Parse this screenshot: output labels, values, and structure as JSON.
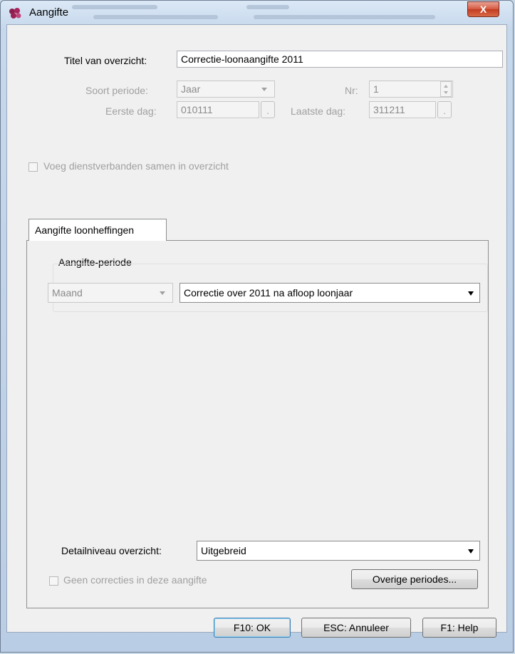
{
  "window": {
    "title": "Aangifte",
    "close_label": "X"
  },
  "form": {
    "titel_label": "Titel van overzicht:",
    "titel_value": "Correctie-loonaangifte 2011",
    "soort_label": "Soort periode:",
    "soort_value": "Jaar",
    "nr_label": "Nr:",
    "nr_value": "1",
    "eerste_label": "Eerste dag:",
    "eerste_value": "010111",
    "laatste_label": "Laatste dag:",
    "laatste_value": "311211",
    "date_btn_label": ".",
    "voeg_label": "Voeg dienstverbanden samen in overzicht"
  },
  "tabs": [
    {
      "label": "Aangifte loonheffingen",
      "selected": true
    }
  ],
  "aangifte": {
    "group_title": "Aangifte-periode",
    "maand_value": "Maand",
    "periode_value": "Correctie over 2011 na afloop loonjaar"
  },
  "detail": {
    "label": "Detailniveau overzicht:",
    "value": "Uitgebreid",
    "geen_label": "Geen correcties in deze aangifte",
    "overige_button": "Overige periodes..."
  },
  "buttons": {
    "ok": "F10: OK",
    "cancel": "ESC: Annuleer",
    "help": "F1: Help"
  }
}
